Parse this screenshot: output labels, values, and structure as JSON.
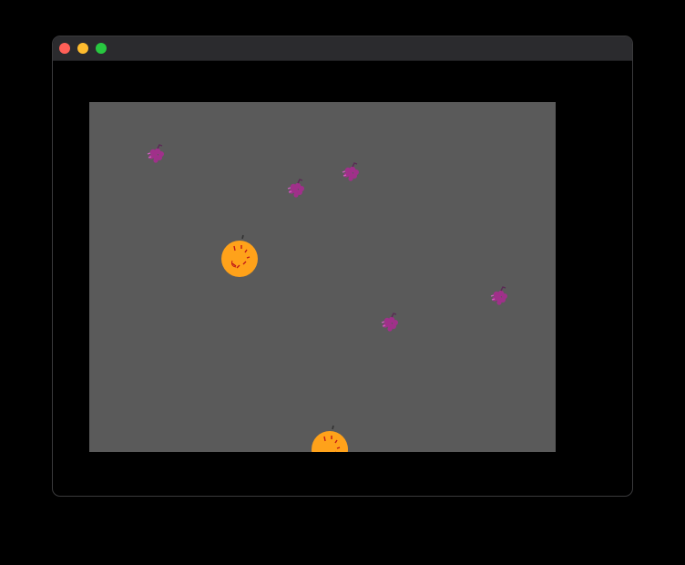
{
  "window": {
    "controls": [
      {
        "name": "close-button",
        "color": "#ff5f57"
      },
      {
        "name": "minimize-button",
        "color": "#febc2e"
      },
      {
        "name": "zoom-button",
        "color": "#28c840"
      }
    ]
  },
  "game": {
    "background": "#5a5a5a",
    "frame_background": "#000000",
    "sprites": [
      {
        "kind": "grapes",
        "icon": "grape-bunch-icon",
        "color": "#a0308a"
      },
      {
        "kind": "grapes",
        "icon": "grape-bunch-icon",
        "color": "#a0308a"
      },
      {
        "kind": "grapes",
        "icon": "grape-bunch-icon",
        "color": "#a0308a"
      },
      {
        "kind": "grapes",
        "icon": "grape-bunch-icon",
        "color": "#a0308a"
      },
      {
        "kind": "grapes",
        "icon": "grape-bunch-icon",
        "color": "#a0308a"
      },
      {
        "kind": "orange",
        "icon": "orange-fruit-icon",
        "color": "#ffa21a",
        "state": "whole"
      },
      {
        "kind": "orange",
        "icon": "orange-fruit-icon",
        "color": "#ffa21a",
        "state": "whole"
      }
    ]
  }
}
